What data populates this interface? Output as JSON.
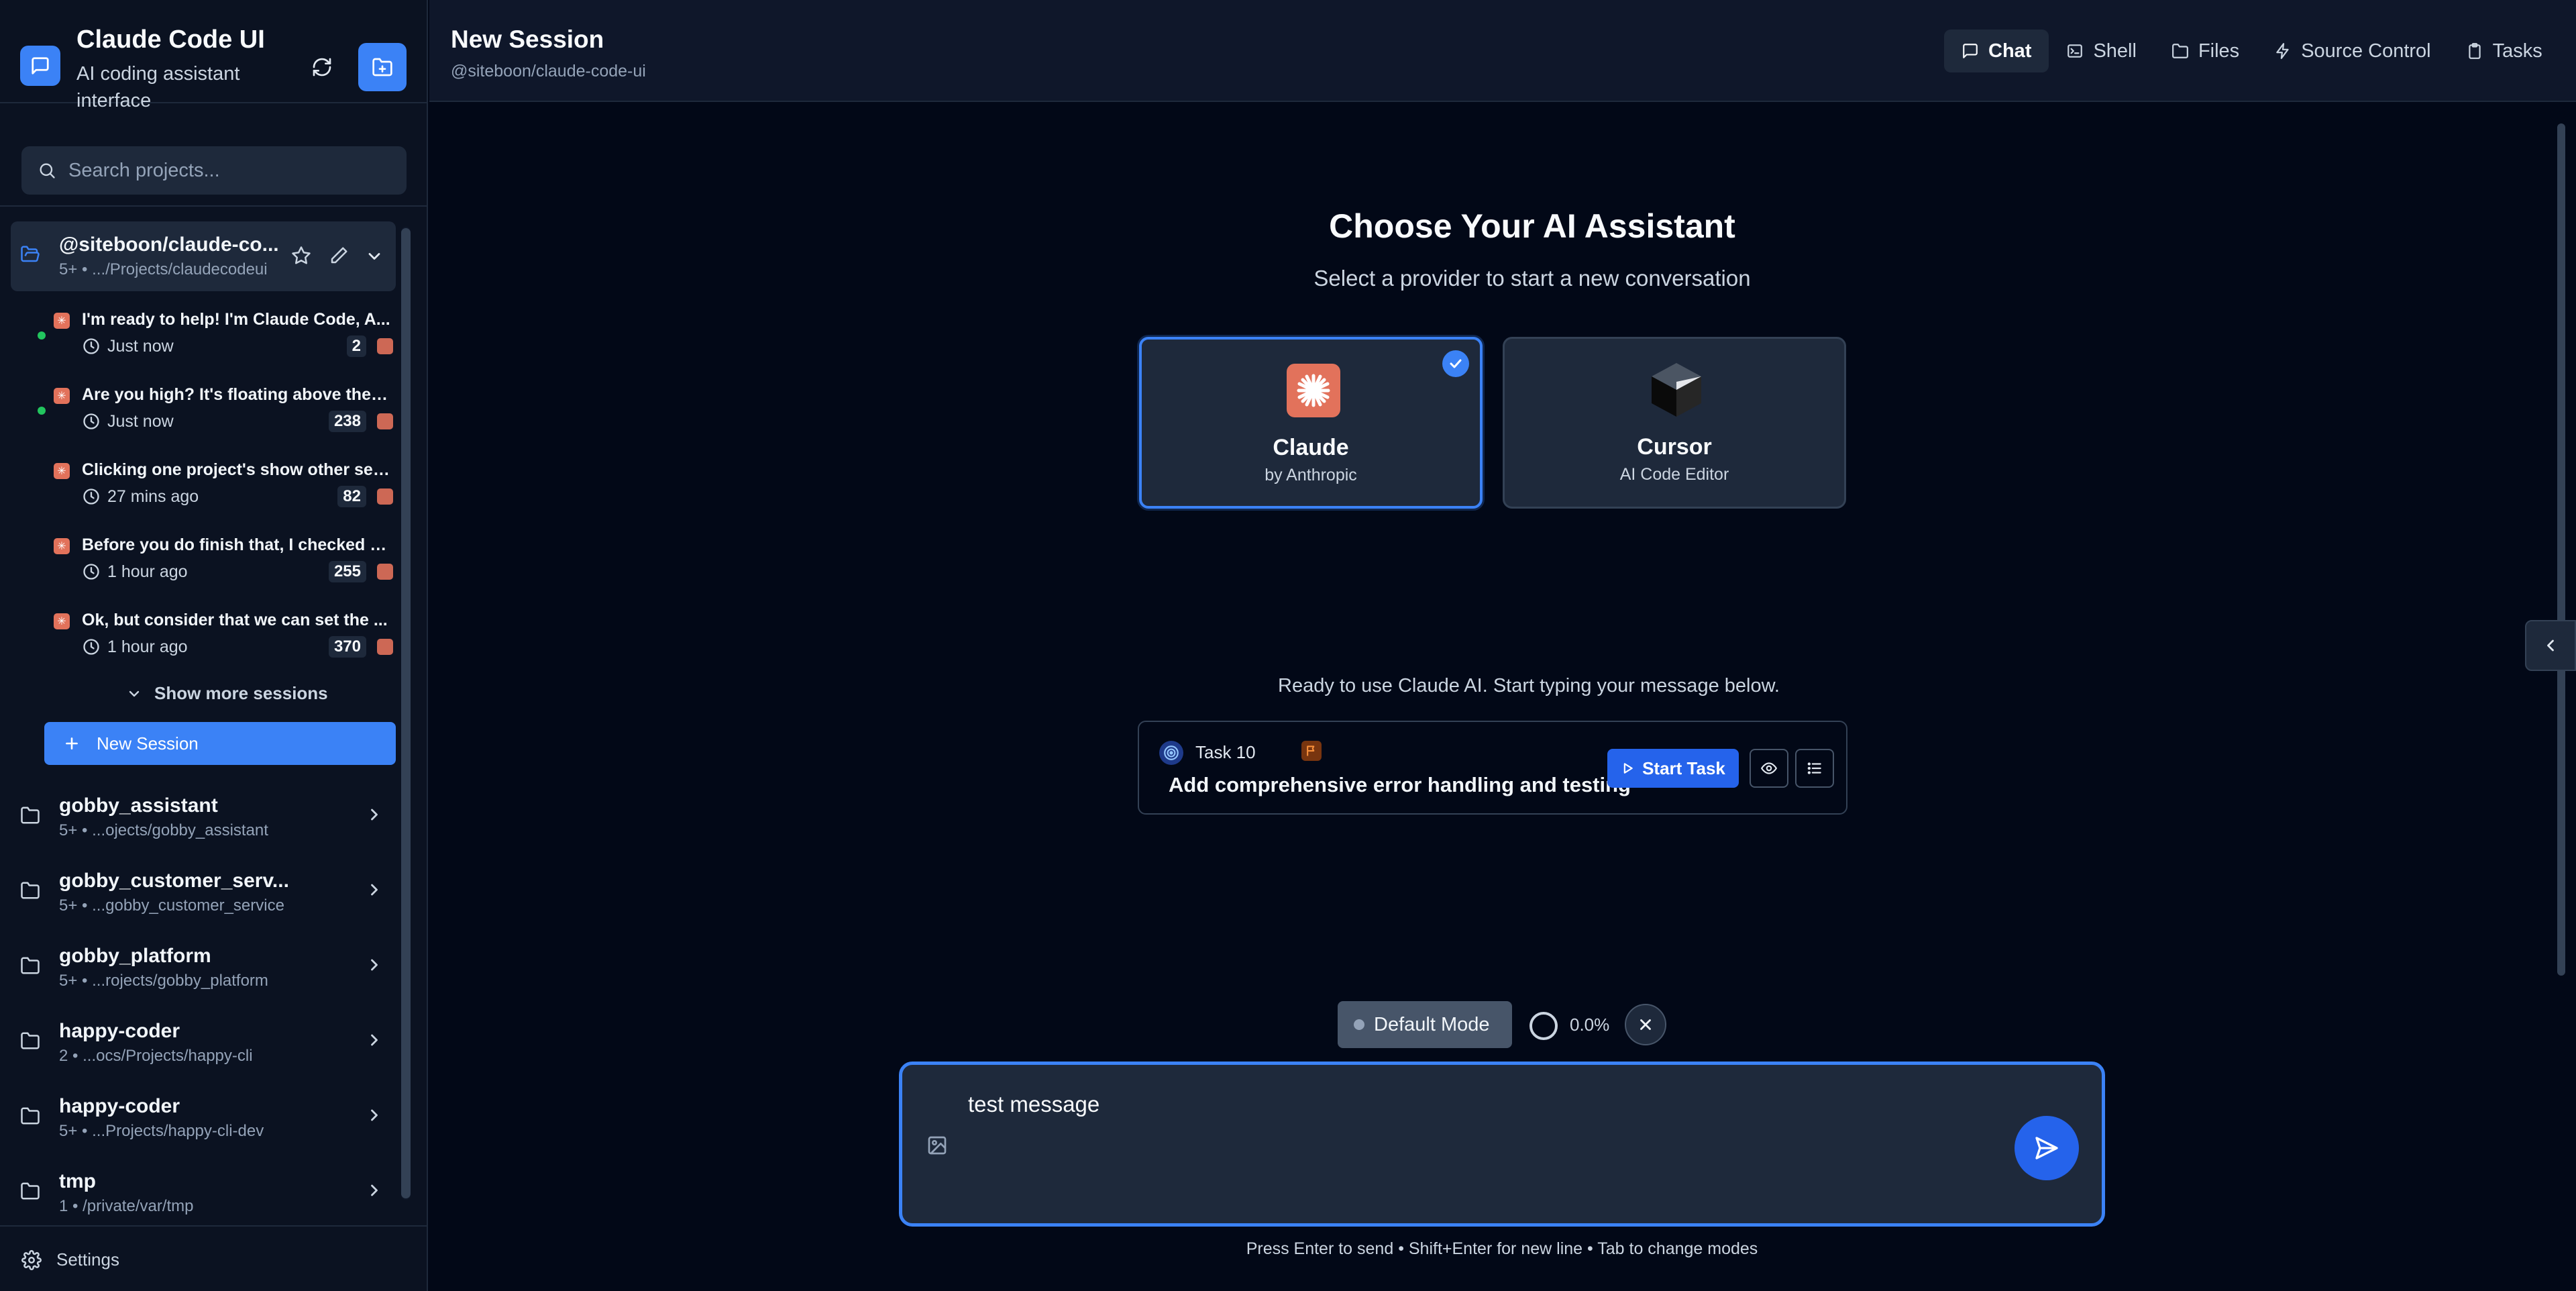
{
  "app": {
    "title": "Claude Code UI",
    "subtitle": "AI coding assistant interface",
    "accent": "#3b82f6"
  },
  "search": {
    "placeholder": "Search projects..."
  },
  "active_project": {
    "name": "@siteboon/claude-co...",
    "count": "5+",
    "path": ".../Projects/claudecodeui"
  },
  "sessions": [
    {
      "title": "I'm ready to help! I'm Claude Code, A...",
      "time": "Just now",
      "count": "2",
      "active": true
    },
    {
      "title": "Are you high? It's floating above the r...",
      "time": "Just now",
      "count": "238",
      "active": true
    },
    {
      "title": "Clicking one project's show other ses...",
      "time": "27 mins ago",
      "count": "82",
      "active": false
    },
    {
      "title": "Before you do finish that, I checked a...",
      "time": "1 hour ago",
      "count": "255",
      "active": false
    },
    {
      "title": "Ok, but consider that we can set the ...",
      "time": "1 hour ago",
      "count": "370",
      "active": false
    }
  ],
  "show_more_label": "Show more sessions",
  "new_session_label": "New Session",
  "projects": [
    {
      "name": "gobby_assistant",
      "count": "5+",
      "path": "...ojects/gobby_assistant"
    },
    {
      "name": "gobby_customer_serv...",
      "count": "5+",
      "path": "...gobby_customer_service"
    },
    {
      "name": "gobby_platform",
      "count": "5+",
      "path": "...rojects/gobby_platform"
    },
    {
      "name": "happy-coder",
      "count": "2",
      "path": "...ocs/Projects/happy-cli"
    },
    {
      "name": "happy-coder",
      "count": "5+",
      "path": "...Projects/happy-cli-dev"
    },
    {
      "name": "tmp",
      "count": "1",
      "path": "/private/var/tmp"
    }
  ],
  "settings_label": "Settings",
  "header": {
    "title": "New Session",
    "subtitle": "@siteboon/claude-code-ui"
  },
  "tabs": [
    {
      "label": "Chat",
      "icon": "chat-icon",
      "active": true
    },
    {
      "label": "Shell",
      "icon": "terminal-icon",
      "active": false
    },
    {
      "label": "Files",
      "icon": "folder-icon",
      "active": false
    },
    {
      "label": "Source Control",
      "icon": "git-icon",
      "active": false
    },
    {
      "label": "Tasks",
      "icon": "clipboard-icon",
      "active": false
    }
  ],
  "chooser": {
    "title": "Choose Your AI Assistant",
    "subtitle": "Select a provider to start a new conversation",
    "providers": [
      {
        "name": "Claude",
        "by": "by Anthropic",
        "selected": true,
        "color": "#e2725b"
      },
      {
        "name": "Cursor",
        "by": "AI Code Editor",
        "selected": false,
        "color": "#111111"
      }
    ]
  },
  "ready_text": "Ready to use Claude AI. Start typing your message below.",
  "task": {
    "label": "Task 10",
    "title": "Add comprehensive error handling and testing",
    "start_label": "Start Task"
  },
  "mode": {
    "label": "Default Mode"
  },
  "token_usage": {
    "text": "0.0%",
    "value": 0.0
  },
  "composer": {
    "value": "test message",
    "hint": "Press Enter to send • Shift+Enter for new line • Tab to change modes"
  }
}
